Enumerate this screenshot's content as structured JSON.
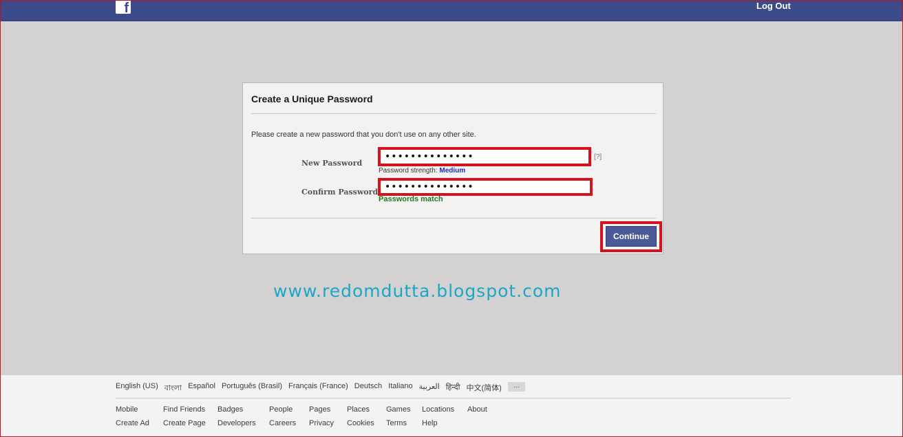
{
  "header": {
    "logo_text": "f",
    "logout_label": "Log Out"
  },
  "dialog": {
    "title": "Create a Unique Password",
    "description": "Please create a new password that you don't use on any other site.",
    "new_password": {
      "label": "New Password",
      "value": "••••••••••••••",
      "help": "[?]",
      "strength_label": "Password strength:",
      "strength_value": "Medium"
    },
    "confirm_password": {
      "label": "Confirm Password",
      "value": "••••••••••••••",
      "status": "Passwords match"
    },
    "continue_label": "Continue"
  },
  "watermark": "www.redomdutta.blogspot.com",
  "footer": {
    "languages": [
      "English (US)",
      "বাংলা",
      "Español",
      "Português (Brasil)",
      "Français (France)",
      "Deutsch",
      "Italiano",
      "العربية",
      "हिन्दी",
      "中文(简体)",
      "..."
    ],
    "links_row1": [
      "Mobile",
      "Find Friends",
      "Badges",
      "People",
      "Pages",
      "Places",
      "Games",
      "Locations",
      "About"
    ],
    "links_row2": [
      "Create Ad",
      "Create Page",
      "Developers",
      "Careers",
      "Privacy",
      "Cookies",
      "Terms",
      "Help"
    ]
  },
  "colors": {
    "topbar": "#3b4b8a",
    "highlight_red": "#d3121e",
    "button": "#4a5a96",
    "strength_medium": "#1a28c8",
    "match_green": "#1f7a1f",
    "watermark": "#1aa7c3"
  }
}
